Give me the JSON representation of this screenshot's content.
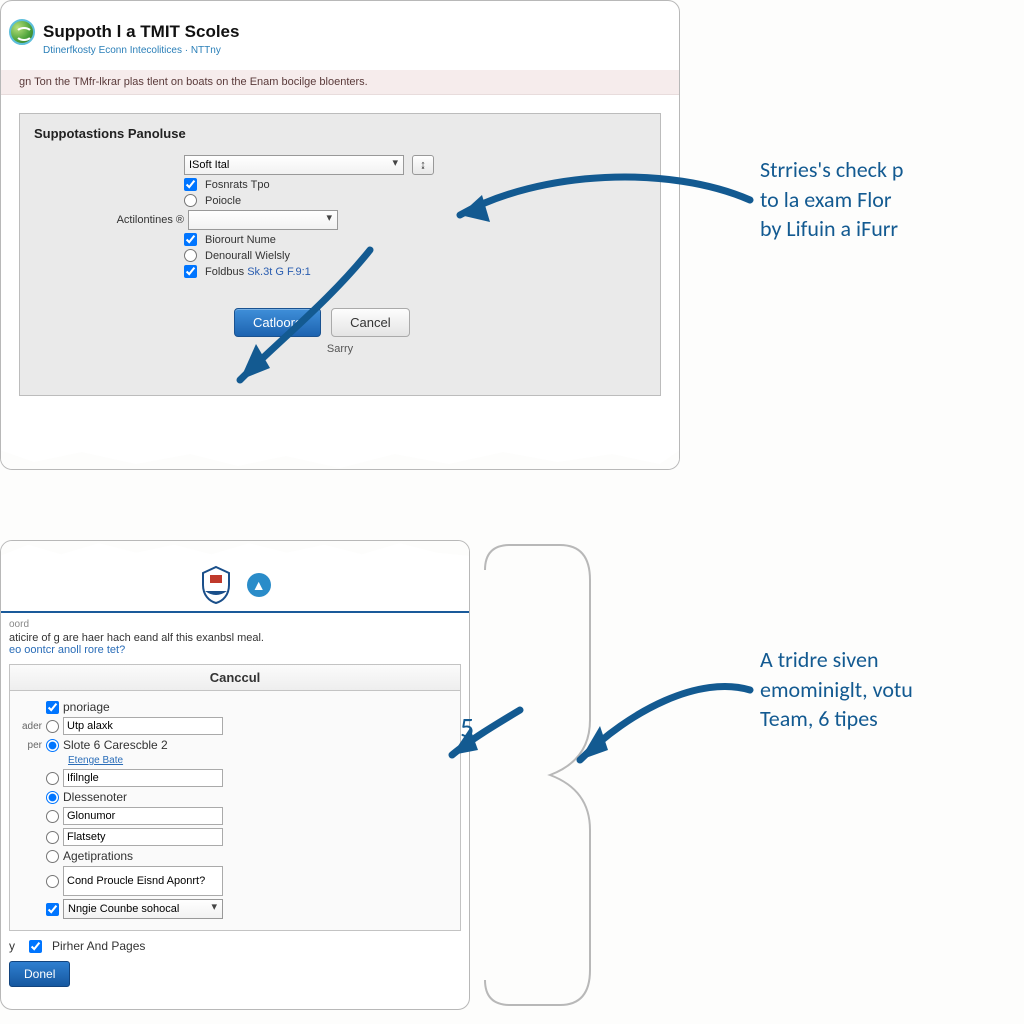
{
  "top": {
    "title": "Suppoth l a TMIT Scoles",
    "subtitle": "Dtinerfkosty Econn Intecolitices · NTTny",
    "notice": "gn Ton the TMfr-lkrar plas tlent on boats on the Enam bocilge bloenters.",
    "form_title": "Suppotastions Panoluse",
    "select1": "ISoft Ital",
    "cb1": "Fosnrats Tpo",
    "rb1": "Poiocle",
    "act_label": "Actilontines ®",
    "select2": "",
    "cb2": "Biorourt Nume",
    "rb2": "Denourall Wielsly",
    "cb3_prefix": "Foldbus ",
    "cb3_link": "Sk.3t G F.9:1",
    "btn_primary": "Catloore",
    "btn_cancel": "Cancel",
    "sarry": "Sarry"
  },
  "bottom": {
    "crumb": "oord",
    "intro_text": "aticire of g are haer hach eand alf this exanbsl meal.",
    "intro_link": "eo oontcr anoll rore tet?",
    "box_title": "Canccul",
    "cb_head": "pnoriage",
    "lab1": "ader",
    "rb1_val": "Utp alaxk",
    "lab2": "per",
    "rb2_lbl": "Slote 6 Carescble 2",
    "link2": "Etenge Bate",
    "rb3_val": "Ifilngle",
    "rb4_lbl": "Dlessenoter",
    "rb5_val": "Glonumor",
    "rb6_val": "Flatsety",
    "rb7_lbl": "Agetiprations",
    "rb8_val": "Cond Proucle Eisnd Aponrt?",
    "cb_sel_val": "Nngie Counbe sohocal",
    "foot_lab": "y",
    "foot_cb": "Pirher And Pages",
    "done": "Donel"
  },
  "annotations": {
    "a1_l1": "Strries's check p",
    "a1_l2": "to la exam Flor",
    "a1_l3": "by Lifuin a iFurr",
    "a2_l1": "A tridre siven",
    "a2_l2": "emominiglt, votu",
    "a2_l3": "Team, 6 tipes",
    "step": "5."
  }
}
